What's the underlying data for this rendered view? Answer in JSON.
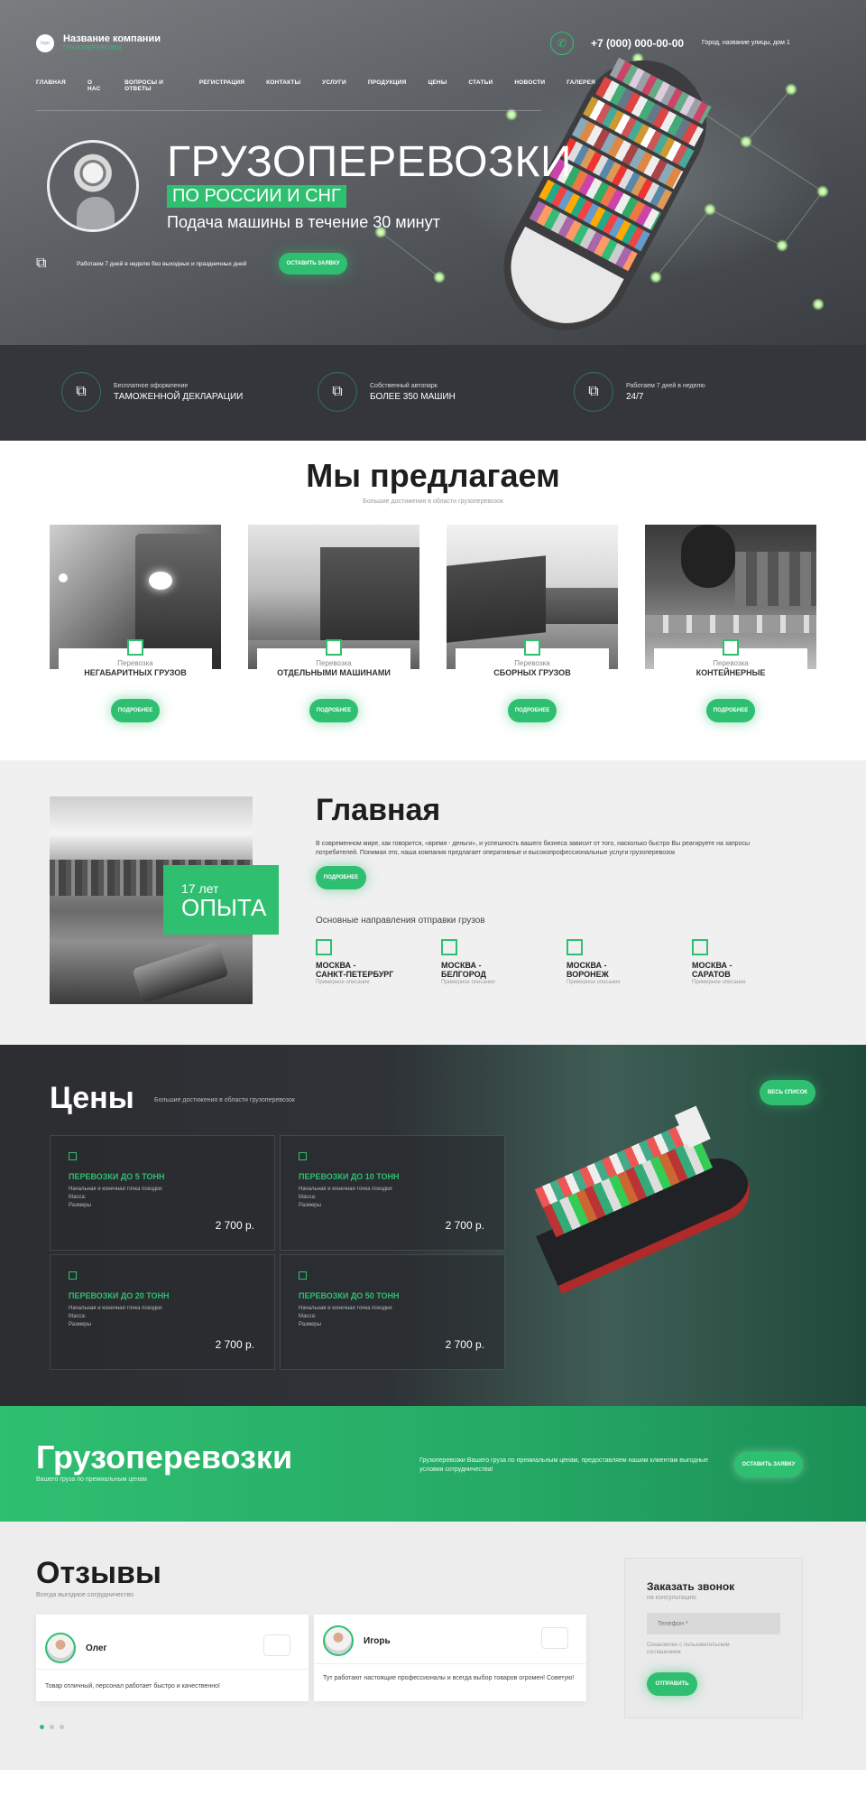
{
  "header": {
    "logo_text": "logo",
    "company_name": "Название компании",
    "company_sub": "ГРУЗОПЕРЕВОЗКИ",
    "phone": "+7 (000) 000-00-00",
    "address": "Город, название улицы, дом 1"
  },
  "nav": [
    "ГЛАВНАЯ",
    "О НАС",
    "ВОПРОСЫ И ОТВЕТЫ",
    "РЕГИСТРАЦИЯ",
    "КОНТАКТЫ",
    "УСЛУГИ",
    "ПРОДУКЦИЯ",
    "ЦЕНЫ",
    "СТАТЬИ",
    "НОВОСТИ",
    "ГАЛЕРЕЯ"
  ],
  "hero": {
    "title": "ГРУЗОПЕРЕВОЗКИ",
    "subtitle_badge": "ПО РОССИИ И СНГ",
    "tagline": "Подача машины в течение 30 минут",
    "work_note": "Работаем 7 дней в неделю без выходных и праздничных дней",
    "cta": "ОСТАВИТЬ ЗАЯВКУ"
  },
  "features": [
    {
      "small": "Бесплатное оформление",
      "big": "ТАМОЖЕННОЙ ДЕКЛАРАЦИИ"
    },
    {
      "small": "Собственный автопарк",
      "big": "БОЛЕЕ 350 МАШИН"
    },
    {
      "small": "Работаем 7 дней в неделю",
      "big": "24/7"
    }
  ],
  "offers": {
    "title": "Мы предлагаем",
    "subtitle": "Большие достижения в области грузоперевозок",
    "items": [
      {
        "small": "Перевозка",
        "big": "НЕГАБАРИТНЫХ ГРУЗОВ",
        "btn": "ПОДРОБНЕЕ"
      },
      {
        "small": "Перевозка",
        "big": "ОТДЕЛЬНЫМИ МАШИНАМИ",
        "btn": "ПОДРОБНЕЕ"
      },
      {
        "small": "Перевозка",
        "big": "СБОРНЫХ ГРУЗОВ",
        "btn": "ПОДРОБНЕЕ"
      },
      {
        "small": "Перевозка",
        "big": "КОНТЕЙНЕРНЫЕ",
        "btn": "ПОДРОБНЕЕ"
      }
    ]
  },
  "about": {
    "exp_small": "17 лет",
    "exp_big": "ОПЫТА",
    "title": "Главная",
    "text": "В современном мире, как говорится, «время - деньги», и успешность вашего бизнеса зависит от того, насколько быстро Вы реагируете на запросы потребителей. Понимая это, наша компания предлагает оперативные и высокопрофессиональные услуги грузоперевозок",
    "btn": "ПОДРОБНЕЕ",
    "directions_title": "Основные направления отправки грузов",
    "directions": [
      {
        "l1": "МОСКВА -",
        "l2": "САНКТ-ПЕТЕРБУРГ",
        "note": "Примерное описание"
      },
      {
        "l1": "МОСКВА -",
        "l2": "БЕЛГОРОД",
        "note": "Примерное описание"
      },
      {
        "l1": "МОСКВА -",
        "l2": "ВОРОНЕЖ",
        "note": "Примерное описание"
      },
      {
        "l1": "МОСКВА -",
        "l2": "САРАТОВ",
        "note": "Примерное описание"
      }
    ]
  },
  "prices": {
    "title": "Цены",
    "subtitle": "Большие достижения в области грузоперевозок",
    "all_btn": "ВЕСЬ СПИСОК",
    "items": [
      {
        "title": "ПЕРЕВОЗКИ ДО 5 ТОНН",
        "d1": "Начальная и конечная точка поездки:",
        "d2": "Масса:",
        "d3": "Размеры",
        "price": "2 700 р."
      },
      {
        "title": "ПЕРЕВОЗКИ ДО 10 ТОНН",
        "d1": "Начальная и конечная точка поездки:",
        "d2": "Масса:",
        "d3": "Размеры",
        "price": "2 700 р."
      },
      {
        "title": "ПЕРЕВОЗКИ ДО 20 ТОНН",
        "d1": "Начальная и конечная точка поездки:",
        "d2": "Масса:",
        "d3": "Размеры",
        "price": "2 700 р."
      },
      {
        "title": "ПЕРЕВОЗКИ ДО 50 ТОНН",
        "d1": "Начальная и конечная точка поездки:",
        "d2": "Масса:",
        "d3": "Размеры",
        "price": "2 700 р."
      }
    ]
  },
  "banner": {
    "title": "Грузоперевозки",
    "sub": "Вашего груза по премиальным ценам",
    "text": "Грузоперевозки Вашего груза по премиальным ценам, предоставляем нашим клиентам выгодные условия сотрудничества!",
    "btn": "ОСТАВИТЬ ЗАЯВКУ"
  },
  "reviews": {
    "title": "Отзывы",
    "subtitle": "Всегда выгодное сотрудничество",
    "items": [
      {
        "name": "Олег",
        "text": "Товар отличный, персонал работает быстро и качественно!"
      },
      {
        "name": "Игорь",
        "text": "Тут работают настоящие профессионалы и всегда выбор товаров огромен! Советую!"
      }
    ]
  },
  "callback": {
    "title": "Заказать звонок",
    "sub": "на консультацию",
    "placeholder": "Телефон *",
    "agree": "Ознакомлен с пользовательским соглашением",
    "btn": "ОТПРАВИТЬ"
  }
}
